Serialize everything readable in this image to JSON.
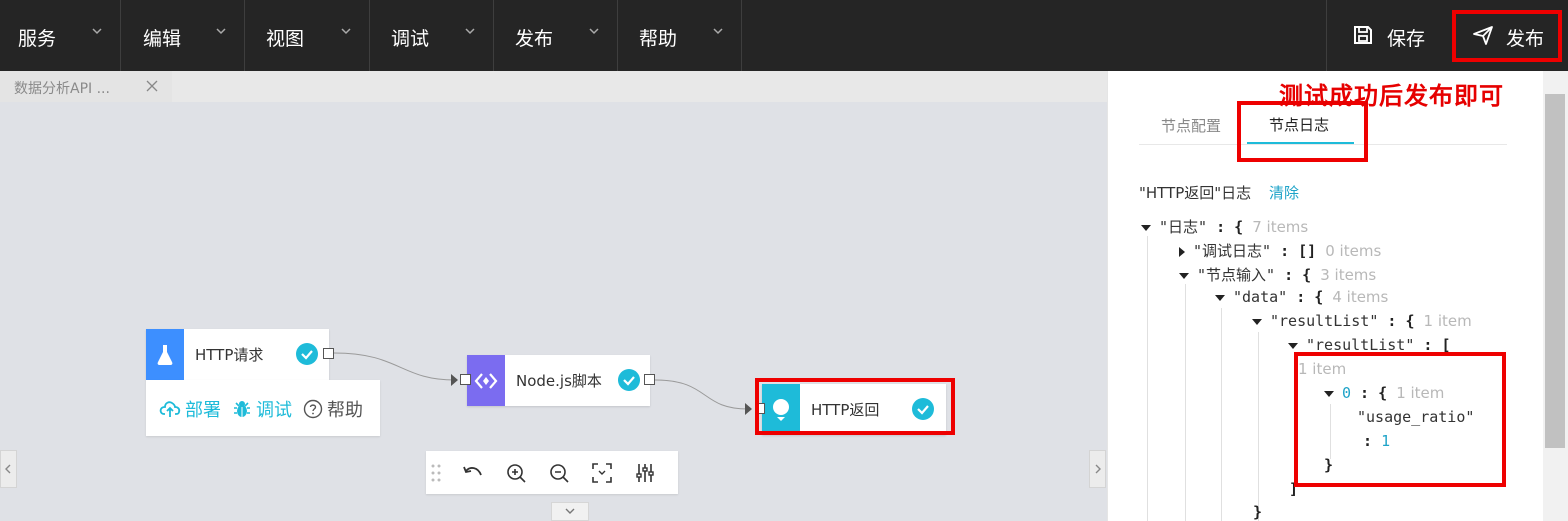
{
  "menu": {
    "items": [
      {
        "label": "服务"
      },
      {
        "label": "编辑"
      },
      {
        "label": "视图"
      },
      {
        "label": "调试"
      },
      {
        "label": "发布"
      },
      {
        "label": "帮助"
      }
    ],
    "save_label": "保存",
    "publish_label": "发布"
  },
  "file_tab": {
    "label": "数据分析API ..."
  },
  "flow": {
    "nodes": [
      {
        "title": "HTTP请求",
        "icon": "flask-icon",
        "color": "#3d8fff"
      },
      {
        "title": "Node.js脚本",
        "icon": "code-icon",
        "color": "#7b6cf0"
      },
      {
        "title": "HTTP返回",
        "icon": "bulb-icon",
        "color": "#1ebbd9"
      }
    ],
    "node_actions": {
      "deploy": "部署",
      "debug": "调试",
      "help": "帮助"
    }
  },
  "panel": {
    "tabs": [
      {
        "label": "节点配置",
        "active": false
      },
      {
        "label": "节点日志",
        "active": true
      }
    ],
    "log_title": "\"HTTP返回\"日志",
    "clear_label": "清除",
    "tree": {
      "root_key": "\"日志\"",
      "root_meta": "7 items",
      "debug_key": "\"调试日志\"",
      "debug_meta": "0 items",
      "input_key": "\"节点输入\"",
      "input_meta": "3 items",
      "data_key": "\"data\"",
      "data_meta": "4 items",
      "result_key": "\"resultList\"",
      "result_meta": "1 item",
      "result2_key": "\"resultList\"",
      "result2_meta": "1 item",
      "item_index": "0",
      "item_meta": "1 item",
      "usage_key": "\"usage_ratio\"",
      "usage_value": "1"
    }
  },
  "annotation": "测试成功后发布即可",
  "colors": {
    "accent": "#1ebbd9",
    "highlight": "#ee0000",
    "topbar": "#252525"
  }
}
